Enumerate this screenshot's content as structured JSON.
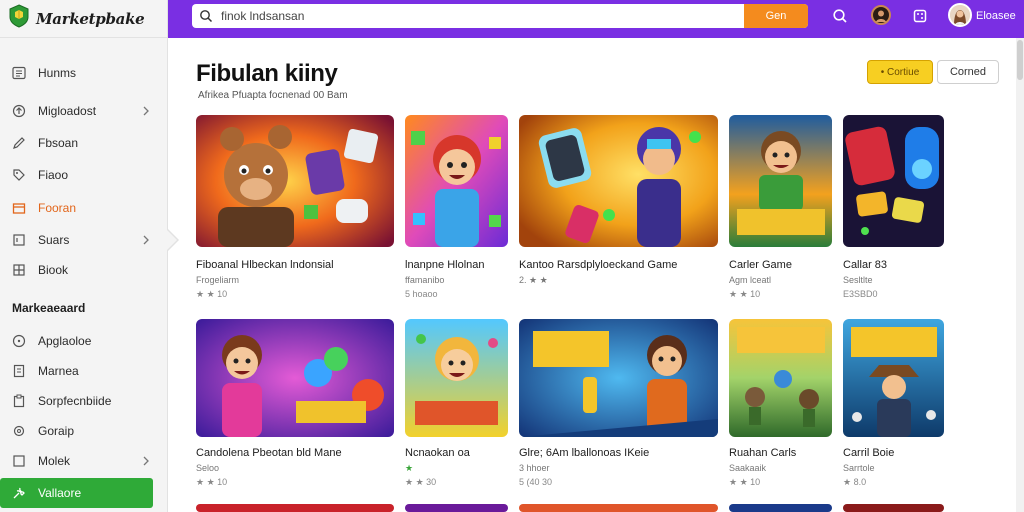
{
  "brand": {
    "name": "Marketpbake"
  },
  "sidebar": {
    "items": [
      {
        "label": "Hunms",
        "icon": "list-icon",
        "chevron": false,
        "highlight": false
      },
      {
        "label": "Migloadost",
        "icon": "upload-icon",
        "chevron": true,
        "highlight": false
      },
      {
        "label": "Fbsoan",
        "icon": "pen-icon",
        "chevron": false,
        "highlight": false
      },
      {
        "label": "Fiaoo",
        "icon": "tag-icon",
        "chevron": false,
        "highlight": false
      },
      {
        "label": "Fooran",
        "icon": "box-icon",
        "chevron": false,
        "highlight": true
      },
      {
        "label": "Suars",
        "icon": "square-icon",
        "chevron": true,
        "highlight": false
      },
      {
        "label": "Biook",
        "icon": "grid-icon",
        "chevron": false,
        "highlight": false
      }
    ],
    "section_title": "Markeaeaard",
    "section_items": [
      {
        "label": "Apglaoloe",
        "icon": "circle-icon",
        "chevron": false
      },
      {
        "label": "Marnea",
        "icon": "document-icon",
        "chevron": false
      },
      {
        "label": "Sorpfecnbiide",
        "icon": "clipboard-icon",
        "chevron": false
      },
      {
        "label": "Goraip",
        "icon": "gear-icon",
        "chevron": false
      },
      {
        "label": "Molek",
        "icon": "square-icon",
        "chevron": true
      },
      {
        "label": "Vallaore",
        "icon": "wrench-icon",
        "chevron": false,
        "active": true
      }
    ]
  },
  "search": {
    "value": "finok lndsansan",
    "button_label": "Gen"
  },
  "user": {
    "name": "Eloasee"
  },
  "page": {
    "title": "Fibulan kiiny",
    "subtitle": "Afrikea Pfuapta focnenad 00 Bam",
    "primary_button": "• Cortiue",
    "secondary_button": "Corned"
  },
  "colors": {
    "topbar": "#7a2fe3",
    "active_nav": "#2faa38",
    "search_button": "#f48b1e",
    "primary_button": "#f7cf22"
  },
  "games": [
    {
      "title": "Fiboanal Hlbeckan lndonsial",
      "meta": "Frogeliarm",
      "rating": "★ ★ 10",
      "art": "bear"
    },
    {
      "title": "lnanpne Hlolnan",
      "meta": "ffamanibo",
      "rating": "5 hoaoo",
      "art": "girl"
    },
    {
      "title": "Kantoo Rarsdplyloeckand Game",
      "meta": "2. ★ ★",
      "rating": "",
      "art": "hero"
    },
    {
      "title": "Carler Game",
      "meta": "Agm lceatl",
      "rating": "★ ★ 10",
      "art": "boy"
    },
    {
      "title": "Callar 83",
      "meta": "Sesltlte",
      "rating": "E3SBD0",
      "art": "blocks"
    },
    {
      "title": "Candolena Pbeotan bld Mane",
      "meta": "Seloo",
      "rating": "★ ★ 10",
      "art": "kid"
    },
    {
      "title": "Ncnaokan oa",
      "meta": "★",
      "rating": "★ ★ 30",
      "art": "macro"
    },
    {
      "title": "Glre; 6Am lballonoas IKeie",
      "meta": "3 hhoer",
      "rating": "5 (40 30",
      "art": "wizard"
    },
    {
      "title": "Ruahan Carls",
      "meta": "Saakaaik",
      "rating": "★ ★ 10",
      "art": "nodass"
    },
    {
      "title": "Carril Boie",
      "meta": "Sarrtole",
      "rating": "★ 8.0",
      "art": "ursoars"
    }
  ]
}
